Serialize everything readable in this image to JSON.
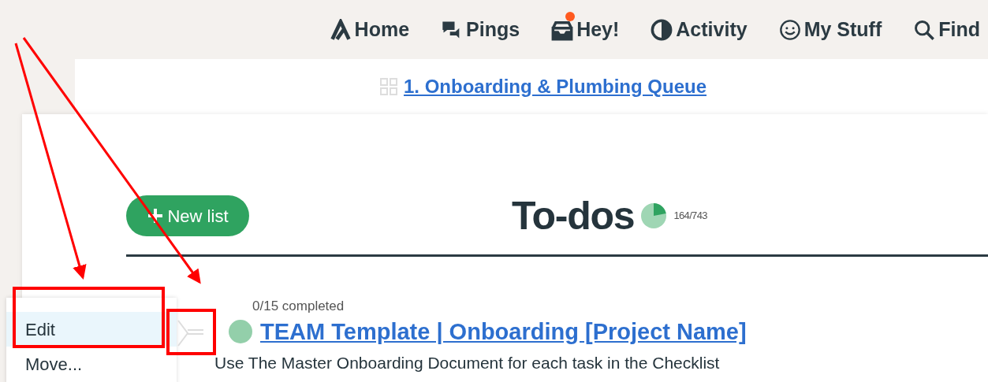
{
  "nav": [
    {
      "kind": "home",
      "label": "Home",
      "badge": false
    },
    {
      "kind": "pings",
      "label": "Pings",
      "badge": false
    },
    {
      "kind": "hey",
      "label": "Hey!",
      "badge": true
    },
    {
      "kind": "activity",
      "label": "Activity",
      "badge": false
    },
    {
      "kind": "mystuff",
      "label": "My Stuff",
      "badge": false
    },
    {
      "kind": "find",
      "label": "Find",
      "badge": false
    }
  ],
  "breadcrumb": "1. Onboarding & Plumbing Queue",
  "new_list_button": "New list",
  "title": "To-dos",
  "progress": {
    "reading": "164/743"
  },
  "list": {
    "completed": "0/15 completed",
    "title": "TEAM Template | Onboarding [Project Name]",
    "description": "Use The Master Onboarding Document for each task in the Checklist"
  },
  "menu": [
    {
      "label": "Edit",
      "selected": true
    },
    {
      "label": "Move...",
      "selected": false
    }
  ]
}
